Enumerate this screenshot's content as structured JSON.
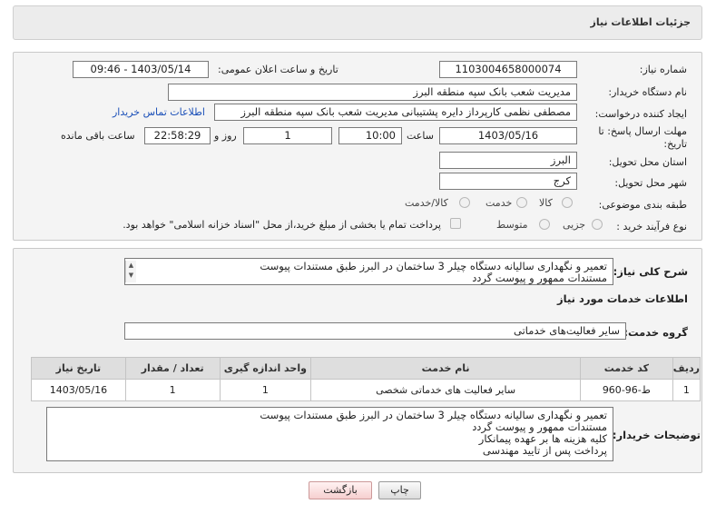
{
  "header": {
    "title": "جزئیات اطلاعات نیاز"
  },
  "form": {
    "need_number_label": "شماره نیاز:",
    "need_number": "1103004658000074",
    "announce_label": "تاریخ و ساعت اعلان عمومی:",
    "announce_value": "1403/05/14 - 09:46",
    "buyer_label": "نام دستگاه خریدار:",
    "buyer_value": "مدیریت شعب بانک سپه منطقه البرز",
    "requester_label": "ایجاد کننده درخواست:",
    "requester_value": "مصطفی نظمی کارپرداز دایره پشتیبانی مدیریت شعب بانک سپه منطقه البرز",
    "contact_link": "اطلاعات تماس خریدار",
    "deadline_label": "مهلت ارسال پاسخ: تا تاریخ:",
    "deadline_date": "1403/05/16",
    "time_label": "ساعت",
    "deadline_time": "10:00",
    "days_value": "1",
    "days_label": "روز و",
    "remaining_time": "22:58:29",
    "remaining_label": "ساعت باقی مانده",
    "province_label": "استان محل تحویل:",
    "province_value": "البرز",
    "city_label": "شهر محل تحویل:",
    "city_value": "کرج",
    "category_label": "طبقه بندی موضوعی:",
    "category_options": [
      "کالا",
      "خدمت",
      "کالا/خدمت"
    ],
    "process_label": "نوع فرآیند خرید :",
    "process_options": [
      "جزیی",
      "متوسط"
    ],
    "payment_note": "پرداخت تمام یا بخشی از مبلغ خرید،از محل \"اسناد خزانه اسلامی\" خواهد بود."
  },
  "description": {
    "label": "شرح کلی نیاز:",
    "text": "تعمیر و نگهداری سالیانه دستگاه چیلر 3 ساختمان در البرز طبق مستندات پیوست\nمستندات ممهور و پیوست گردد",
    "services_heading": "اطلاعات خدمات مورد نیاز",
    "group_label": "گروه خدمت:",
    "group_value": "سایر فعالیت‌های خدماتی"
  },
  "table": {
    "headers": [
      "ردیف",
      "کد خدمت",
      "نام خدمت",
      "واحد اندازه گیری",
      "تعداد / مقدار",
      "تاریخ نیاز"
    ],
    "rows": [
      [
        "1",
        "ط-96-960",
        "سایر فعالیت های خدماتی شخصی",
        "1",
        "1",
        "1403/05/16"
      ]
    ]
  },
  "buyer_notes": {
    "label": "توضیحات خریدار:",
    "text": "تعمیر و نگهداری سالیانه دستگاه چیلر 3 ساختمان در البرز طبق مستندات پیوست\nمستندات ممهور و پیوست گردد\nکلیه هزینه ها بر عهده پیمانکار\nپرداخت پس از تایید مهندسی"
  },
  "buttons": {
    "print": "چاپ",
    "back": "بازگشت"
  },
  "icons": {
    "scroll": "scroll-arrows-icon"
  }
}
